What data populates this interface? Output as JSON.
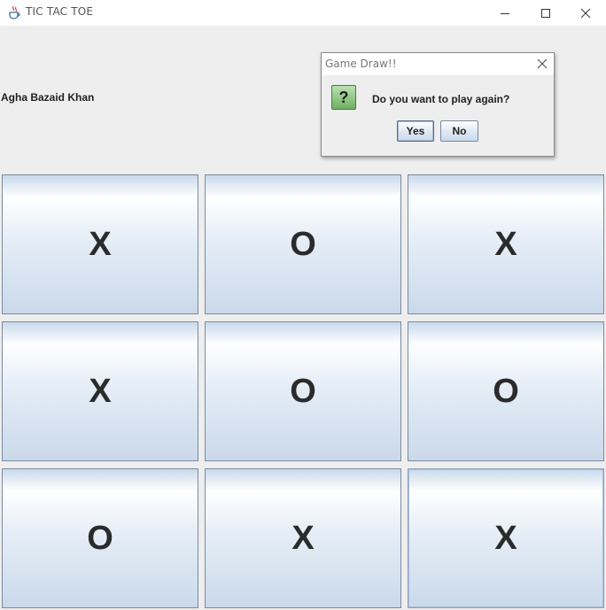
{
  "window": {
    "title": "TIC TAC TOE",
    "icons": {
      "app": "java-cup-icon",
      "minimize": "minimize-icon",
      "maximize": "maximize-icon",
      "close": "close-icon"
    }
  },
  "header": {
    "player_name": "Agha Bazaid Khan"
  },
  "dialog": {
    "title": "Game Draw!!",
    "icon": "question-icon",
    "icon_glyph": "?",
    "message": "Do you want to play again?",
    "yes_label": "Yes",
    "no_label": "No"
  },
  "board": {
    "cells": [
      "X",
      "O",
      "X",
      "X",
      "O",
      "O",
      "O",
      "X",
      "X"
    ]
  },
  "colors": {
    "background": "#eeeeee",
    "button_gradient_top": "#ffffff",
    "button_gradient_bottom": "#cad9ea",
    "mark": "#2b2b2b"
  }
}
